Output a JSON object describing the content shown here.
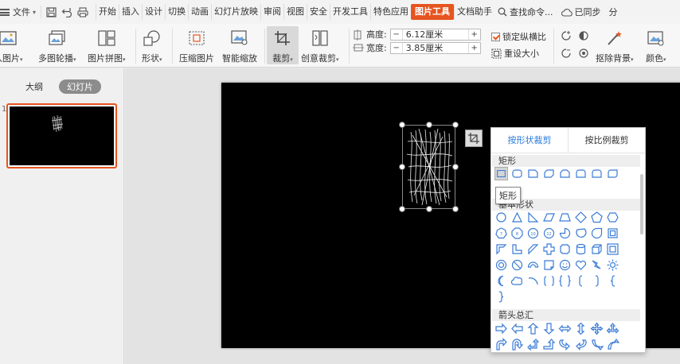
{
  "menubar": {
    "file_label": "文件",
    "tabs": [
      "开始",
      "插入",
      "设计",
      "切换",
      "动画",
      "幻灯片放映",
      "审阅",
      "视图",
      "安全",
      "开发工具",
      "特色应用",
      "图片工具",
      "文档助手"
    ],
    "active_tab": "图片工具",
    "search_label": "查找命令...",
    "sync_label": "已同步",
    "share_label": "分"
  },
  "ribbon": {
    "insert_picture": "入图片",
    "multi_carousel": "多图轮播",
    "picture_collage": "图片拼图",
    "shape": "形状",
    "compress": "压缩图片",
    "smart_zoom": "智能缩放",
    "crop": "裁剪",
    "creative_crop": "创意裁剪",
    "height_label": "高度:",
    "height_value": "6.12厘米",
    "width_label": "宽度:",
    "width_value": "3.85厘米",
    "lock_ratio": "锁定纵横比",
    "reset_size": "重设大小",
    "remove_bg": "抠除背景",
    "color": "颜色"
  },
  "leftpanel": {
    "outline_tab": "大纲",
    "slides_tab": "幻灯片",
    "slide_number": "1"
  },
  "croppanel": {
    "tab_shape": "按形状裁剪",
    "tab_ratio": "按比例裁剪",
    "section_rect": "矩形",
    "section_basic": "基本形状",
    "section_arrows": "箭头总汇",
    "tooltip": "矩形"
  },
  "colors": {
    "accent": "#e6551f",
    "link": "#2a7bdc",
    "shape_outline": "#3a7bd5"
  }
}
